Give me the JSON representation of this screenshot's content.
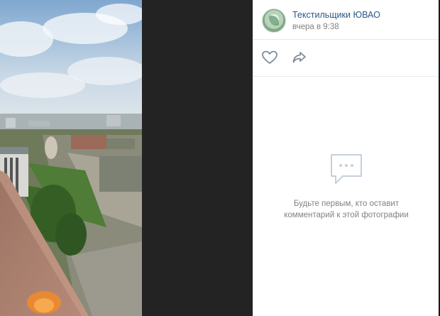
{
  "author": {
    "name": "Текстильщики ЮВАО",
    "date": "вчера в 9:38"
  },
  "actions": {
    "like_icon": "heart-outline-icon",
    "share_icon": "share-arrow-icon"
  },
  "comments": {
    "empty_line_1": "Будьте первым, кто оставит",
    "empty_line_2": "комментарий к этой фотографии",
    "empty_icon": "comment-bubble-icon"
  },
  "colors": {
    "link": "#2a5885",
    "muted": "#828282",
    "divider": "#e7e8ec"
  }
}
